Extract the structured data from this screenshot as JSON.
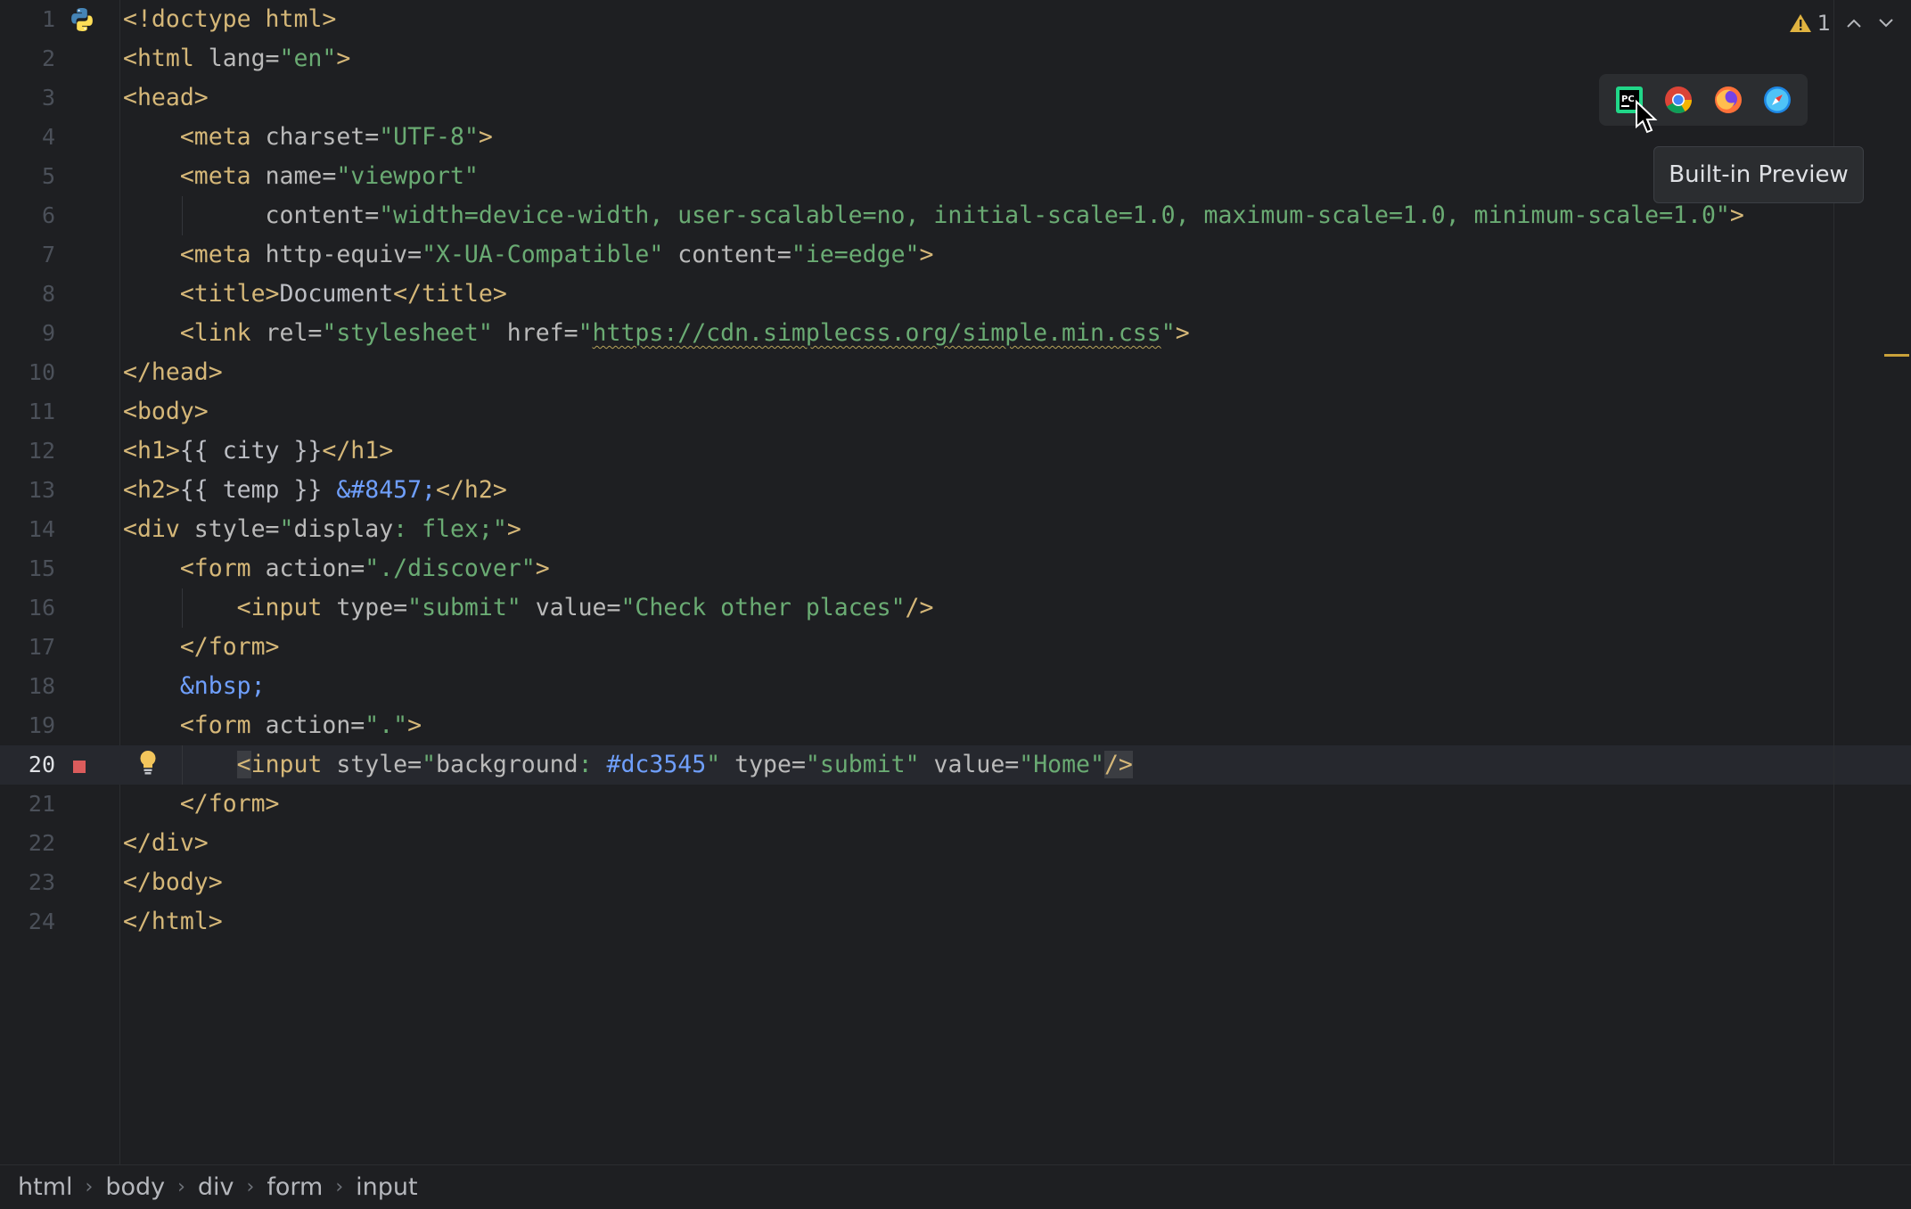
{
  "editor": {
    "current_line": 20,
    "lines": [
      {
        "n": "1",
        "tokens": [
          [
            "t",
            "<!doctype html>"
          ]
        ]
      },
      {
        "n": "2",
        "tokens": [
          [
            "t",
            "<html "
          ],
          [
            "a",
            "lang="
          ],
          [
            "s",
            "\"en\""
          ],
          [
            "t",
            ">"
          ]
        ]
      },
      {
        "n": "3",
        "tokens": [
          [
            "t",
            "<head>"
          ]
        ]
      },
      {
        "n": "4",
        "tokens": [
          [
            "p",
            "    "
          ],
          [
            "t",
            "<meta "
          ],
          [
            "a",
            "charset="
          ],
          [
            "s",
            "\"UTF-8\""
          ],
          [
            "t",
            ">"
          ]
        ]
      },
      {
        "n": "5",
        "tokens": [
          [
            "p",
            "    "
          ],
          [
            "t",
            "<meta "
          ],
          [
            "a",
            "name="
          ],
          [
            "s",
            "\"viewport\""
          ]
        ]
      },
      {
        "n": "6",
        "tokens": [
          [
            "p",
            "          "
          ],
          [
            "a",
            "content="
          ],
          [
            "s",
            "\"width=device-width, user-scalable=no, initial-scale=1.0, maximum-scale=1.0, minimum-scale=1.0\""
          ],
          [
            "t",
            ">"
          ]
        ]
      },
      {
        "n": "7",
        "tokens": [
          [
            "p",
            "    "
          ],
          [
            "t",
            "<meta "
          ],
          [
            "a",
            "http-equiv="
          ],
          [
            "s",
            "\"X-UA-Compatible\""
          ],
          [
            "a",
            " content="
          ],
          [
            "s",
            "\"ie=edge\""
          ],
          [
            "t",
            ">"
          ]
        ]
      },
      {
        "n": "8",
        "tokens": [
          [
            "p",
            "    "
          ],
          [
            "t",
            "<title>"
          ],
          [
            "p",
            "Document"
          ],
          [
            "t",
            "</title>"
          ]
        ]
      },
      {
        "n": "9",
        "tokens": [
          [
            "p",
            "    "
          ],
          [
            "t",
            "<link "
          ],
          [
            "a",
            "rel="
          ],
          [
            "s",
            "\"stylesheet\""
          ],
          [
            "a",
            " href="
          ],
          [
            "s",
            "\""
          ],
          [
            "su",
            "https://cdn.simplecss.org/simple.min.css"
          ],
          [
            "s",
            "\""
          ],
          [
            "t",
            ">"
          ]
        ]
      },
      {
        "n": "10",
        "tokens": [
          [
            "t",
            "</head>"
          ]
        ]
      },
      {
        "n": "11",
        "tokens": [
          [
            "t",
            "<body>"
          ]
        ]
      },
      {
        "n": "12",
        "tokens": [
          [
            "t",
            "<h1>"
          ],
          [
            "p",
            "{{ city }}"
          ],
          [
            "t",
            "</h1>"
          ]
        ]
      },
      {
        "n": "13",
        "tokens": [
          [
            "t",
            "<h2>"
          ],
          [
            "p",
            "{{ temp }} "
          ],
          [
            "e",
            "&#8457;"
          ],
          [
            "t",
            "</h2>"
          ]
        ]
      },
      {
        "n": "14",
        "tokens": [
          [
            "t",
            "<div "
          ],
          [
            "a",
            "style="
          ],
          [
            "s",
            "\""
          ],
          [
            "a",
            "display"
          ],
          [
            "s",
            ": flex;\""
          ],
          [
            "t",
            ">"
          ]
        ]
      },
      {
        "n": "15",
        "tokens": [
          [
            "p",
            "    "
          ],
          [
            "t",
            "<form "
          ],
          [
            "a",
            "action="
          ],
          [
            "s",
            "\"./discover\""
          ],
          [
            "t",
            ">"
          ]
        ]
      },
      {
        "n": "16",
        "tokens": [
          [
            "p",
            "        "
          ],
          [
            "t",
            "<input "
          ],
          [
            "a",
            "type="
          ],
          [
            "s",
            "\"submit\""
          ],
          [
            "a",
            " value="
          ],
          [
            "s",
            "\"Check other places\""
          ],
          [
            "t",
            "/>"
          ]
        ]
      },
      {
        "n": "17",
        "tokens": [
          [
            "p",
            "    "
          ],
          [
            "t",
            "</form>"
          ]
        ]
      },
      {
        "n": "18",
        "tokens": [
          [
            "p",
            "    "
          ],
          [
            "e",
            "&nbsp;"
          ]
        ]
      },
      {
        "n": "19",
        "tokens": [
          [
            "p",
            "    "
          ],
          [
            "t",
            "<form "
          ],
          [
            "a",
            "action="
          ],
          [
            "s",
            "\"."
          ],
          [
            "s",
            "\""
          ],
          [
            "t",
            ">"
          ]
        ]
      },
      {
        "n": "20",
        "tokens": [
          [
            "p",
            "        "
          ],
          [
            "tc",
            "<"
          ],
          [
            "t",
            "input "
          ],
          [
            "a",
            "style="
          ],
          [
            "s",
            "\""
          ],
          [
            "a",
            "background"
          ],
          [
            "s",
            ": "
          ],
          [
            "e",
            "#dc3545"
          ],
          [
            "s",
            "\""
          ],
          [
            "a",
            " type="
          ],
          [
            "s",
            "\"submit\""
          ],
          [
            "a",
            " value="
          ],
          [
            "s",
            "\"Home\""
          ],
          [
            "tc",
            "/>"
          ]
        ]
      },
      {
        "n": "21",
        "tokens": [
          [
            "p",
            "    "
          ],
          [
            "t",
            "</form>"
          ]
        ]
      },
      {
        "n": "22",
        "tokens": [
          [
            "t",
            "</div>"
          ]
        ]
      },
      {
        "n": "23",
        "tokens": [
          [
            "t",
            "</body>"
          ]
        ]
      },
      {
        "n": "24",
        "tokens": [
          [
            "t",
            "</html>"
          ]
        ]
      }
    ]
  },
  "inspection": {
    "warning_count": "1"
  },
  "tooltip": {
    "text": "Built-in Preview"
  },
  "browser_icons": [
    "pycharm-preview-icon",
    "chrome-icon",
    "firefox-icon",
    "safari-icon"
  ],
  "breadcrumbs": [
    "html",
    "body",
    "div",
    "form",
    "input"
  ],
  "colors": {
    "tag": "#d5b778",
    "attr": "#bababa",
    "string": "#6aab73",
    "entity": "#6f9ffc",
    "background": "#1e1f22"
  }
}
